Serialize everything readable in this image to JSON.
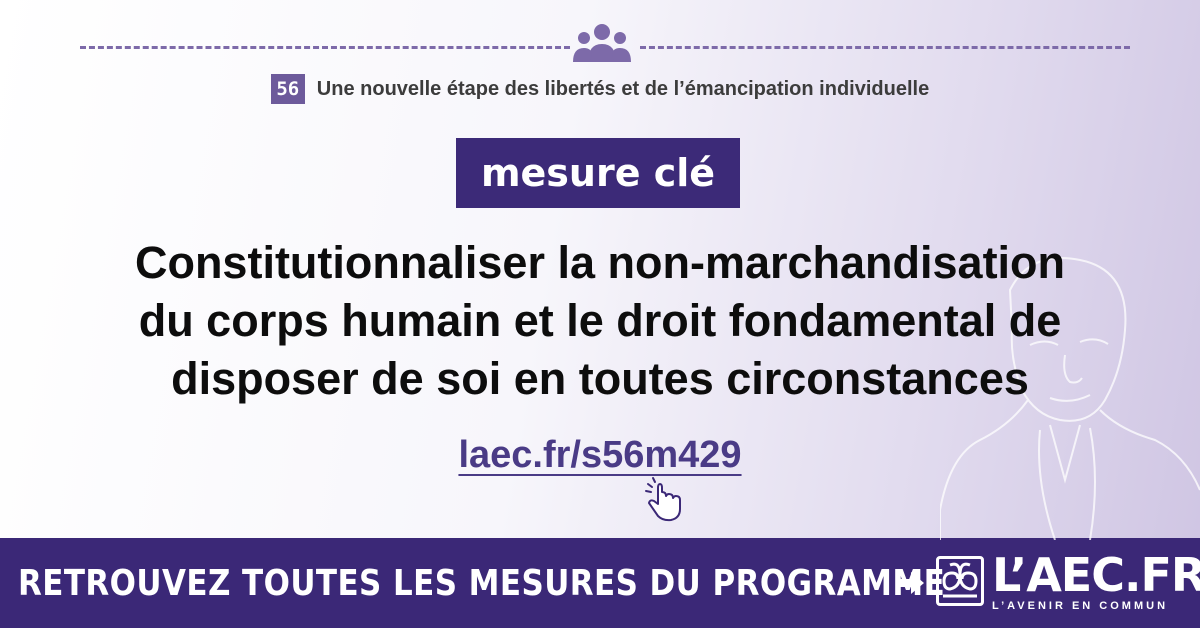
{
  "header": {
    "chapter_number": "56",
    "chapter_title": "Une nouvelle étape des libertés et de l’émancipation individuelle"
  },
  "badge": {
    "label": "mesure clé"
  },
  "headline": {
    "lines": [
      "Constitutionnaliser la non-marchandisation",
      "du corps humain et le droit fondamental de",
      "disposer de soi en toutes circonstances"
    ]
  },
  "link": {
    "text": "laec.fr/s56m429"
  },
  "footer": {
    "cta": "RETROUVEZ TOUTES LES MESURES DU PROGRAMME",
    "brand": "L’AEC.FR",
    "brand_sub": "L’AVENIR EN COMMUN"
  },
  "icons": {
    "group": "people-group-icon",
    "hand": "pointing-hand-icon",
    "arrow": "arrow-right-icon",
    "logo": "book-logo-icon"
  },
  "colors": {
    "accent": "#3b2877",
    "chapter_badge": "#6d5a9b",
    "link": "#4a3b86"
  }
}
